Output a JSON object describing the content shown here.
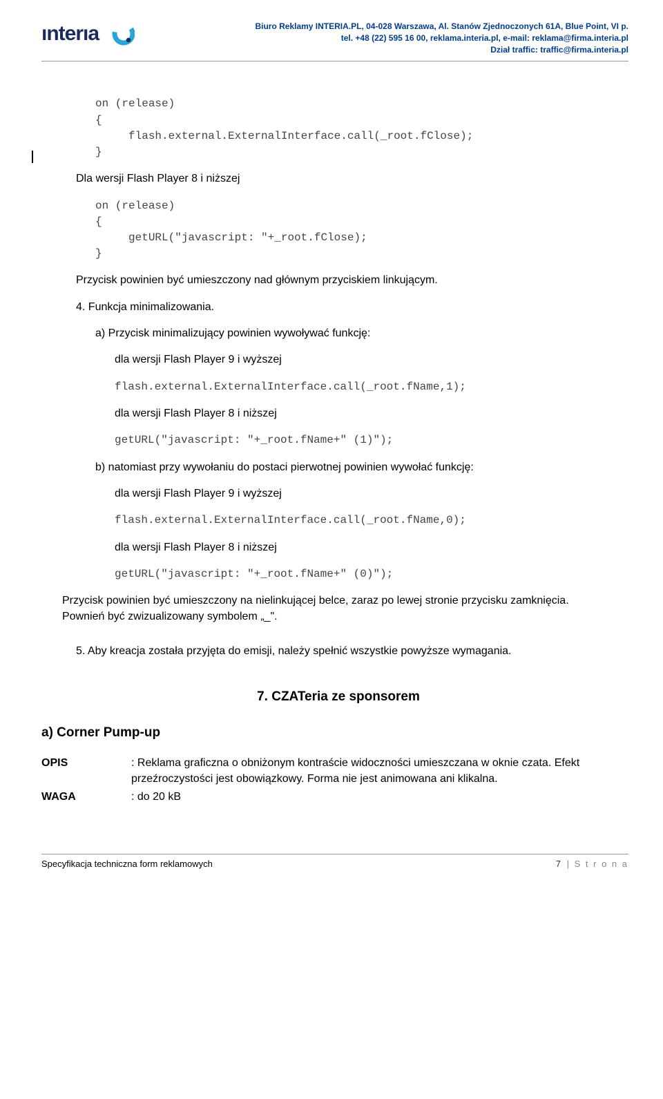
{
  "header": {
    "line1": "Biuro Reklamy INTERIA.PL, 04-028 Warszawa, Al. Stanów Zjednoczonych 61A, Blue Point, VI p.",
    "line2": "tel. +48 (22) 595 16 00, reklama.interia.pl, e-mail: reklama@firma.interia.pl",
    "line3": "Dział traffic: traffic@firma.interia.pl"
  },
  "code": {
    "c1": "on (release)\n{\n     flash.external.ExternalInterface.call(_root.fClose);\n}",
    "c2": "on (release)\n{\n     getURL(\"javascript: \"+_root.fClose);\n}",
    "c3": "flash.external.ExternalInterface.call(_root.fName,1);",
    "c4": "getURL(\"javascript: \"+_root.fName+\" (1)\");",
    "c5": "flash.external.ExternalInterface.call(_root.fName,0);",
    "c6": "getURL(\"javascript: \"+_root.fName+\" (0)\");"
  },
  "text": {
    "p1": "Dla wersji Flash Player 8 i niższej",
    "p2": "Przycisk powinien być umieszczony nad głównym przyciskiem linkującym.",
    "n4": "4.  Funkcja minimalizowania.",
    "a": "a)  Przycisk minimalizujący powinien wywoływać funkcję:",
    "v9": "dla wersji Flash Player 9 i wyższej",
    "v8": "dla wersji Flash Player 8 i niższej",
    "b": "b)  natomiast  przy wywołaniu do postaci pierwotnej  powinien wywołać funkcję:",
    "p3": "Przycisk powinien być umieszczony na nielinkującej belce, zaraz po lewej stronie przycisku zamknięcia. Pownień być zwizualizowany symbolem „_\".",
    "n5": "5.  Aby kreacja została przyjęta do emisji, należy spełnić wszystkie powyższe wymagania.",
    "h7": "7. CZATeria ze sponsorem",
    "sa": "a) Corner Pump-up",
    "opis_label": "OPIS",
    "opis_val": ": Reklama graficzna o obniżonym kontraście widoczności umieszczana w oknie czata. Efekt przeźroczystości jest obowiązkowy. Forma nie jest animowana ani klikalna.",
    "waga_label": "WAGA",
    "waga_val": ": do 20 kB"
  },
  "footer": {
    "left": "Specyfikacja techniczna form reklamowych",
    "pagenum": "7",
    "pagesep": " | ",
    "pagetext": "S t r o n a"
  }
}
